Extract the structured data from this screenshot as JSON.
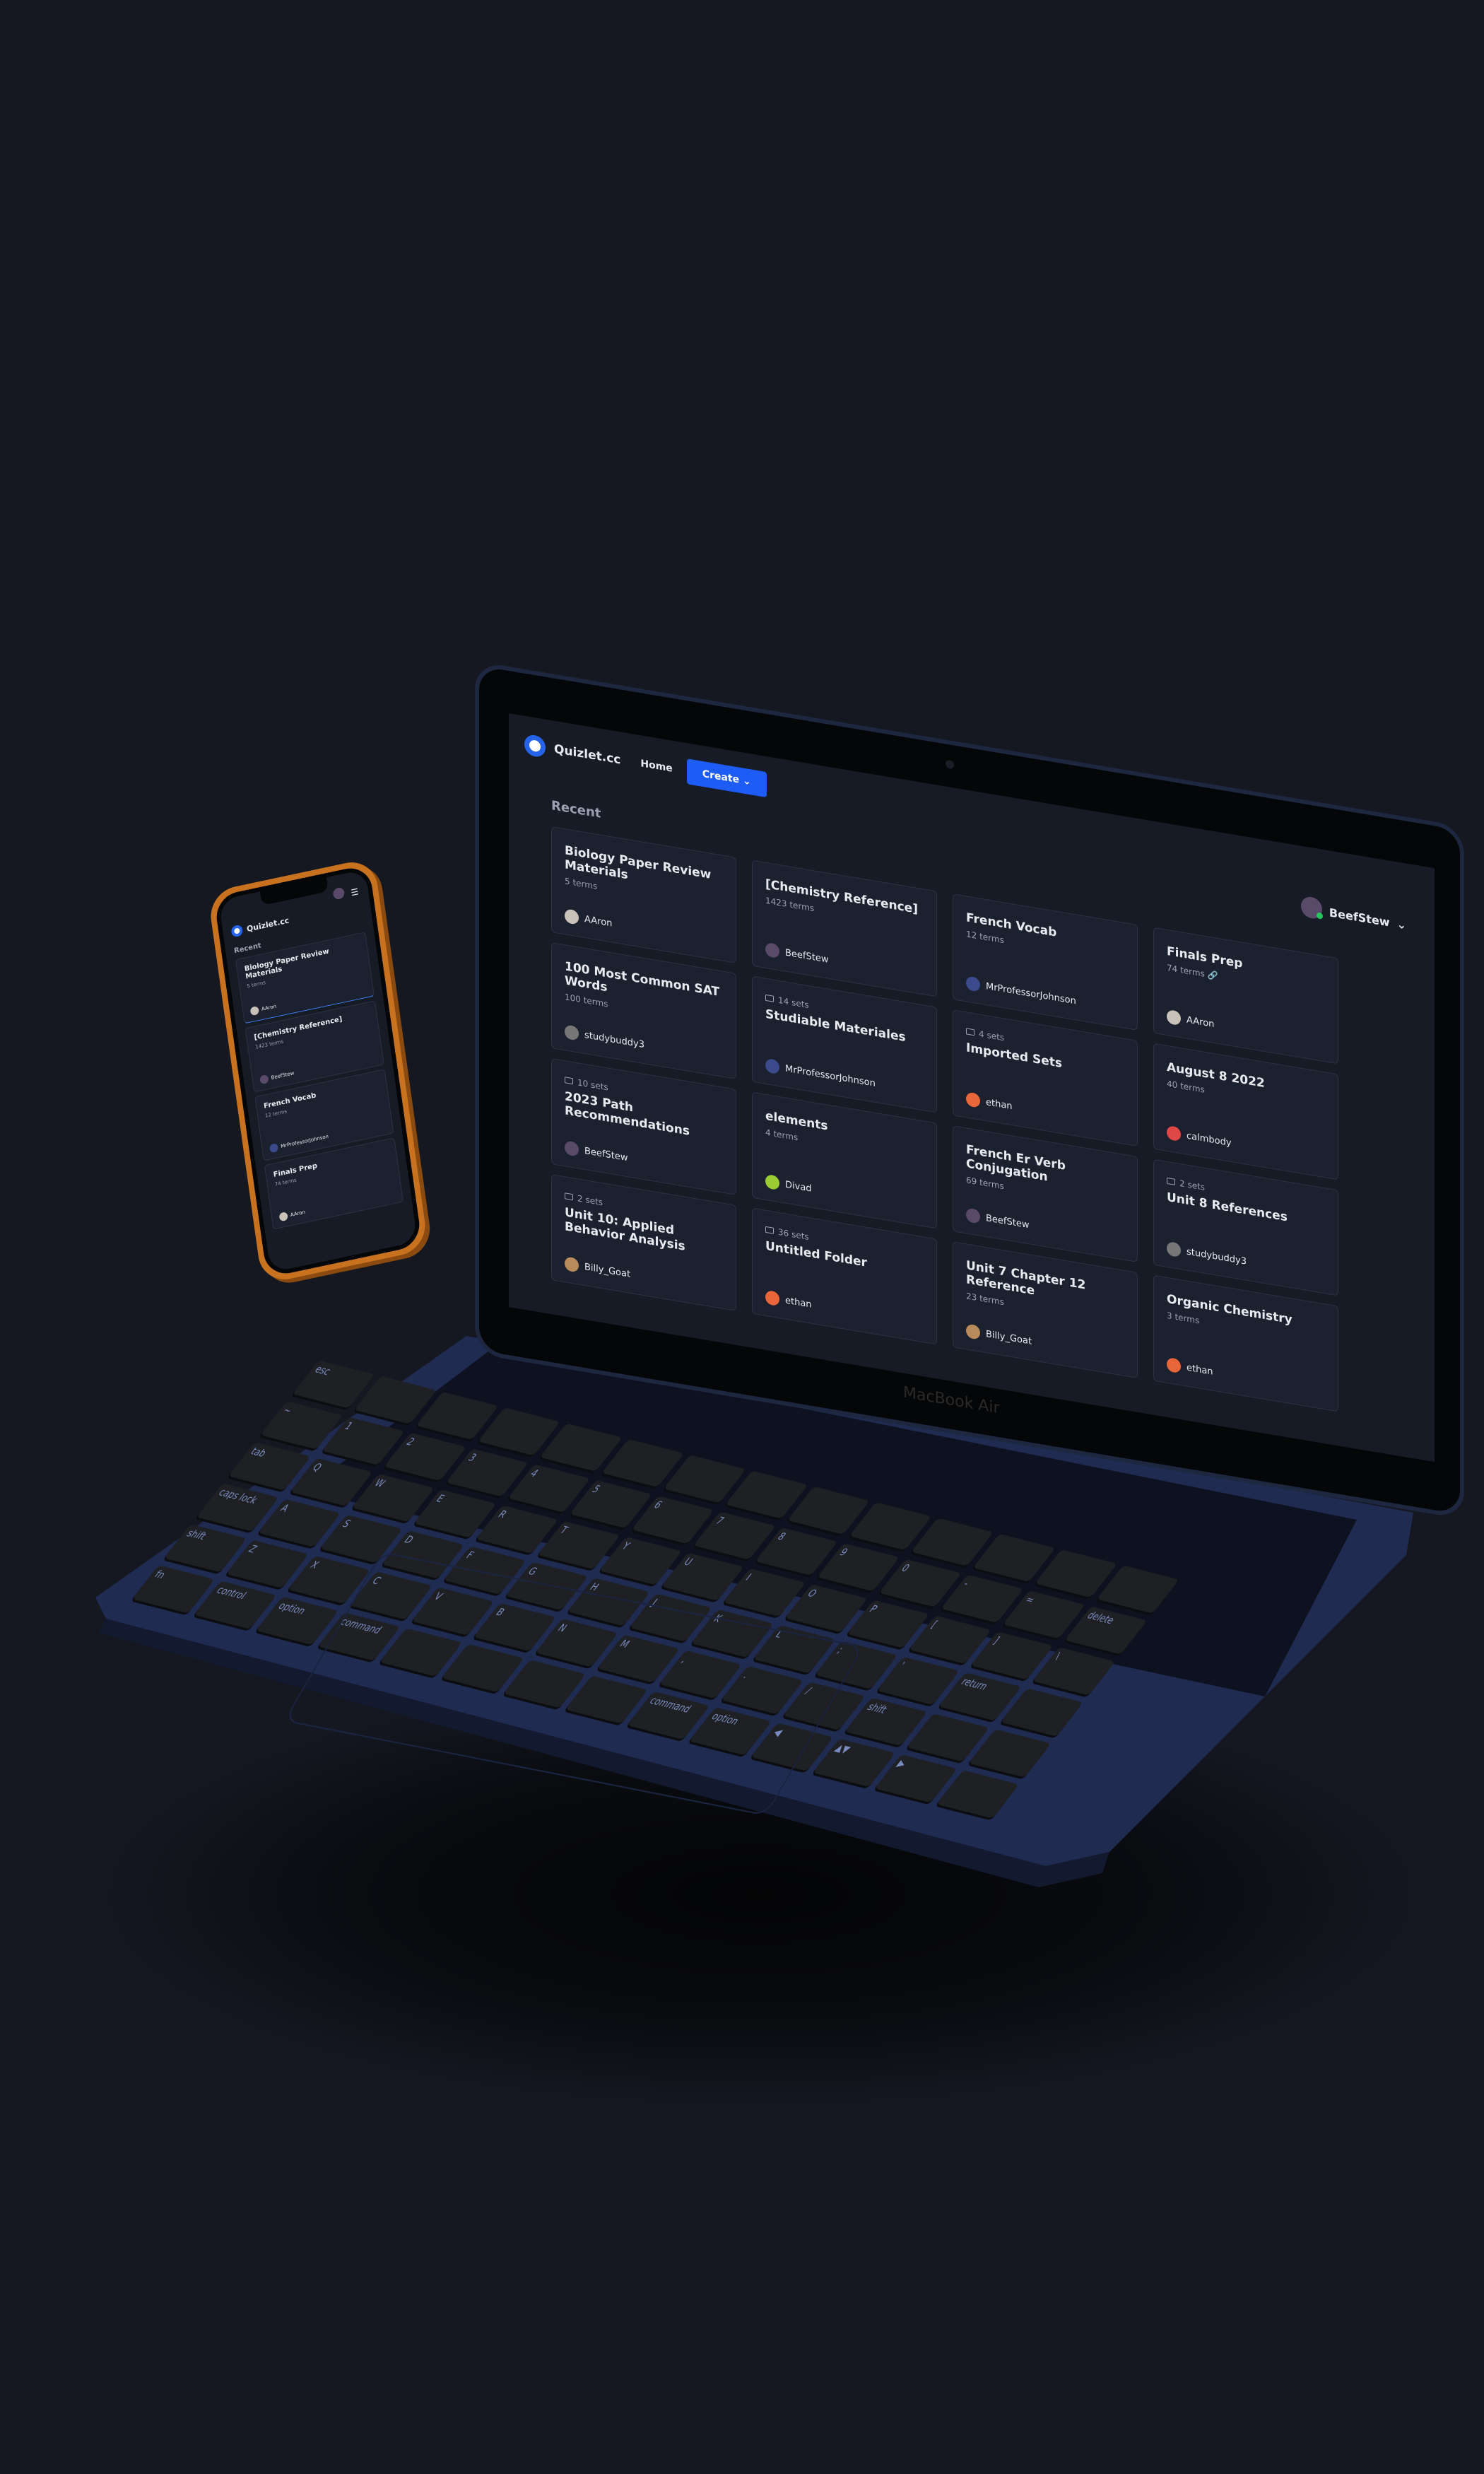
{
  "app": {
    "brand": "Quizlet.cc",
    "nav_home": "Home",
    "create_label": "Create",
    "recent_label": "Recent"
  },
  "user": {
    "name": "BeefStew",
    "status_color": "#22c55e"
  },
  "colors": {
    "background": "#151821",
    "accent": "#1d5cf6",
    "card": "#1c2130",
    "laptop_body": "#1f2b50",
    "phone_frame": "#c8721f"
  },
  "device": {
    "laptop_label": "MacBook Air"
  },
  "cards": [
    {
      "title": "Biology Paper Review Materials",
      "meta": "5 terms",
      "owner": "AAron",
      "avatar": "#c9c2b8"
    },
    {
      "title": "[Chemistry Reference]",
      "meta": "1423 terms",
      "owner": "BeefStew",
      "avatar": "#5a4a6a"
    },
    {
      "title": "French Vocab",
      "meta": "12 terms",
      "owner": "MrProfessorJohnson",
      "avatar": "#3a4a8a"
    },
    {
      "title": "Finals Prep",
      "meta": "74 terms",
      "owner": "AAron",
      "avatar": "#c9c2b8",
      "link_icon": true
    },
    {
      "title": "100 Most Common SAT Words",
      "meta": "100 terms",
      "owner": "studybuddy3",
      "avatar": "#777"
    },
    {
      "folder": "14 sets",
      "title": "Studiable Materiales",
      "owner": "MrProfessorJohnson",
      "avatar": "#3a4a8a"
    },
    {
      "folder": "4 sets",
      "title": "Imported Sets",
      "owner": "ethan",
      "avatar": "#e8663a"
    },
    {
      "title": "August 8 2022",
      "meta": "40 terms",
      "owner": "calmbody",
      "avatar": "#e04848"
    },
    {
      "folder": "10 sets",
      "title": "2023 Path Recommendations",
      "owner": "BeefStew",
      "avatar": "#5a4a6a"
    },
    {
      "title": "elements",
      "meta": "4 terms",
      "owner": "Divad",
      "avatar": "#9acd32"
    },
    {
      "title": "French Er Verb Conjugation",
      "meta": "69 terms",
      "owner": "BeefStew",
      "avatar": "#5a4a6a"
    },
    {
      "folder": "2 sets",
      "title": "Unit 8 References",
      "owner": "studybuddy3",
      "avatar": "#777"
    },
    {
      "folder": "2 sets",
      "title": "Unit 10: Applied Behavior Analysis",
      "owner": "Billy_Goat",
      "avatar": "#b98a5a"
    },
    {
      "folder": "36 sets",
      "title": "Untitled Folder",
      "owner": "ethan",
      "avatar": "#e8663a"
    },
    {
      "title": "Unit 7 Chapter 12 Reference",
      "meta": "23 terms",
      "owner": "Billy_Goat",
      "avatar": "#b98a5a"
    },
    {
      "title": "Organic Chemistry",
      "meta": "3 terms",
      "owner": "ethan",
      "avatar": "#e8663a"
    }
  ],
  "phone_cards": [
    {
      "title": "Biology Paper Review Materials",
      "meta": "5 terms",
      "owner": "AAron",
      "avatar": "#c9c2b8"
    },
    {
      "title": "[Chemistry Reference]",
      "meta": "1423 terms",
      "owner": "BeefStew",
      "avatar": "#5a4a6a"
    },
    {
      "title": "French Vocab",
      "meta": "12 terms",
      "owner": "MrProfessorJohnson",
      "avatar": "#3a4a8a"
    },
    {
      "title": "Finals Prep",
      "meta": "74 terms",
      "owner": "AAron",
      "avatar": "#c9c2b8"
    }
  ],
  "keyboard": {
    "keys": [
      "esc",
      "",
      "",
      "",
      "",
      "",
      "",
      "",
      "",
      "",
      "",
      "",
      "",
      "",
      "~",
      "1",
      "2",
      "3",
      "4",
      "5",
      "6",
      "7",
      "8",
      "9",
      "0",
      "-",
      "=",
      "delete",
      "tab",
      "Q",
      "W",
      "E",
      "R",
      "T",
      "Y",
      "U",
      "I",
      "O",
      "P",
      "[",
      "]",
      "\\",
      "caps lock",
      "A",
      "S",
      "D",
      "F",
      "G",
      "H",
      "J",
      "K",
      "L",
      ";",
      "'",
      "return",
      "",
      "shift",
      "Z",
      "X",
      "C",
      "V",
      "B",
      "N",
      "M",
      ",",
      ".",
      "/",
      "shift",
      "",
      "",
      "fn",
      "control",
      "option",
      "command",
      "",
      "",
      "",
      "",
      "command",
      "option",
      "◀",
      "▲▼",
      "▶",
      ""
    ]
  }
}
